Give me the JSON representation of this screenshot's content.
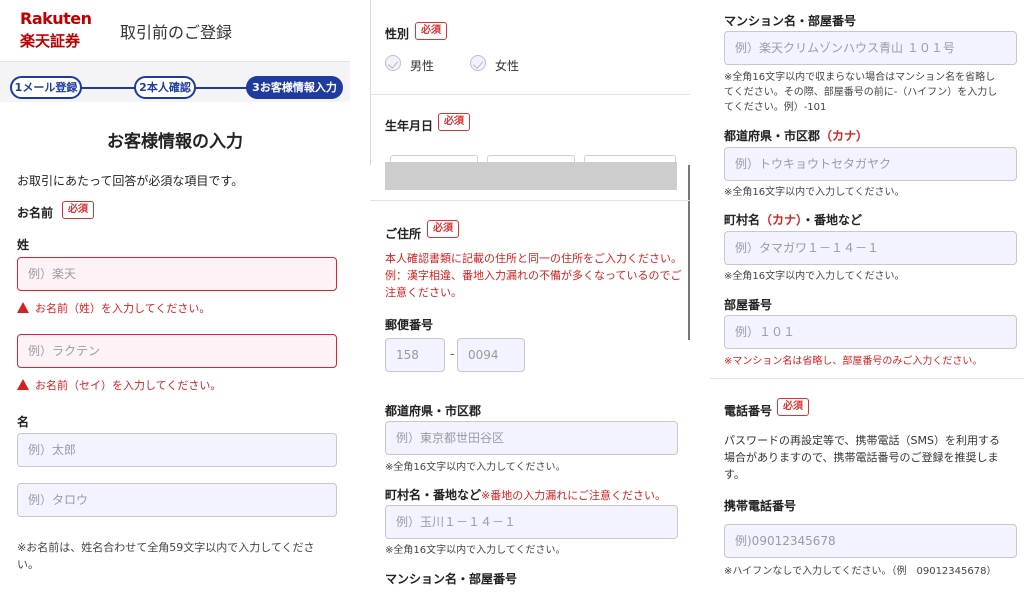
{
  "header": {
    "logo_top": "Rakuten",
    "logo_bottom": "楽天証券",
    "title": "取引前のご登録"
  },
  "steps": [
    {
      "label": "1メール登録",
      "active": false
    },
    {
      "label": "2本人確認",
      "active": false
    },
    {
      "label": "3お客様情報入力",
      "active": true
    }
  ],
  "required_badge": "必須",
  "left": {
    "section_title": "お客様情報の入力",
    "intro": "お取引にあたって回答が必須な項目です。",
    "name_label": "お名前",
    "sei_label": "姓",
    "sei_kanji_placeholder": "例）楽天",
    "sei_kanji_error": "お名前（姓）を入力してください。",
    "sei_kana_placeholder": "例）ラクテン",
    "sei_kana_error": "お名前（セイ）を入力してください。",
    "mei_label": "名",
    "mei_kanji_placeholder": "例）太郎",
    "mei_kana_placeholder": "例）タロウ",
    "name_note_1": "※お名前は、姓名合わせて全角59文字以内で入力してくださ",
    "name_note_2": "い。"
  },
  "middle": {
    "gender_label": "性別",
    "male": "男性",
    "female": "女性",
    "dob_label": "生年月日",
    "address_label": "ご住所",
    "address_warning_1": "本人確認書類に記載の住所と同一の住所をご入力ください。",
    "address_warning_2": "例：漢字相違、番地入力漏れの不備が多くなっているのでご",
    "address_warning_3": "注意ください。",
    "postal_label": "郵便番号",
    "postal_1": "158",
    "postal_sep": "-",
    "postal_2": "0094",
    "pref_label": "都道府県・市区郡",
    "pref_placeholder": "例）東京都世田谷区",
    "pref_note": "※全角16文字以内で入力してください。",
    "town_label": "町村名・番地など",
    "town_warning": "※番地の入力漏れにご注意ください。",
    "town_placeholder": "例）玉川１－１４－１",
    "town_note": "※全角16文字以内で入力してください。",
    "mansion_cut_label": "マンション名・部屋番号"
  },
  "right": {
    "mansion_label": "マンション名・部屋番号",
    "mansion_placeholder": "例）楽天クリムゾンハウス青山 １０１号",
    "mansion_note_1": "※全角16文字以内で収まらない場合はマンション名を省略し",
    "mansion_note_2": "てください。その際、部屋番号の前に-（ハイフン）を入力し",
    "mansion_note_3": "てください。例）-101",
    "pref_kana_label": "都道府県・市区郡",
    "kana_suffix": "（カナ）",
    "pref_kana_placeholder": "例）トウキョウトセタガヤク",
    "pref_kana_note": "※全角16文字以内で入力してください。",
    "town_kana_label_a": "町村名",
    "town_kana_label_b": "・番地など",
    "town_kana_placeholder": "例）タマガワ１－１４－１",
    "town_kana_note": "※全角16文字以内で入力してください。",
    "room_label": "部屋番号",
    "room_placeholder": "例）１０１",
    "room_note": "※マンション名は省略し、部屋番号のみご入力ください。",
    "phone_label": "電話番号",
    "phone_desc_1": "パスワードの再設定等で、携帯電話（SMS）を利用する",
    "phone_desc_2": "場合がありますので、携帯電話番号のご登録を推奨しま",
    "phone_desc_3": "す。",
    "mobile_label": "携帯電話番号",
    "mobile_placeholder": "例)09012345678",
    "mobile_note": "※ハイフンなしで入力してください。（例　09012345678）"
  },
  "colors": {
    "brand": "#bf0000",
    "step_blue": "#1f3c9d",
    "error": "#d42222",
    "input_bg": "#f3f3ff"
  }
}
